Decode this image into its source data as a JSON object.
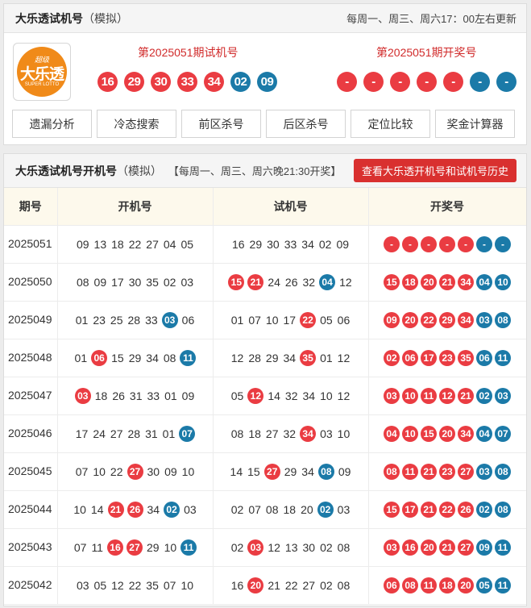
{
  "top": {
    "title": "大乐透试机号",
    "mode": "（模拟）",
    "schedule": "每周一、周三、周六17：00左右更新",
    "logo": {
      "top": "超级",
      "main": "大乐透",
      "sub": "SUPER LOTTO"
    },
    "trial_label": "第2025051期试机号",
    "trial_numbers": {
      "front": [
        "16",
        "29",
        "30",
        "33",
        "34"
      ],
      "back": [
        "02",
        "09"
      ]
    },
    "draw_label": "第2025051期开奖号",
    "draw_numbers": {
      "front": [
        "-",
        "-",
        "-",
        "-",
        "-"
      ],
      "back": [
        "-",
        "-"
      ]
    },
    "tools": [
      "遗漏分析",
      "冷态搜索",
      "前区杀号",
      "后区杀号",
      "定位比较",
      "奖金计算器"
    ]
  },
  "history": {
    "title": "大乐透试机号开机号",
    "mode": "（模拟）",
    "note": "【每周一、周三、周六晚21:30开奖】",
    "button": "查看大乐透开机号和试机号历史",
    "columns": [
      "期号",
      "开机号",
      "试机号",
      "开奖号"
    ],
    "rows": [
      {
        "issue": "2025051",
        "open": [
          [
            "09",
            "n"
          ],
          [
            "13",
            "n"
          ],
          [
            "18",
            "n"
          ],
          [
            "22",
            "n"
          ],
          [
            "27",
            "n"
          ],
          [
            "04",
            "n"
          ],
          [
            "05",
            "n"
          ]
        ],
        "trial": [
          [
            "16",
            "n"
          ],
          [
            "29",
            "n"
          ],
          [
            "30",
            "n"
          ],
          [
            "33",
            "n"
          ],
          [
            "34",
            "n"
          ],
          [
            "02",
            "n"
          ],
          [
            "09",
            "n"
          ]
        ],
        "draw": [
          [
            "-",
            "r"
          ],
          [
            "-",
            "r"
          ],
          [
            "-",
            "r"
          ],
          [
            "-",
            "r"
          ],
          [
            "-",
            "r"
          ],
          [
            "-",
            "b"
          ],
          [
            "-",
            "b"
          ]
        ]
      },
      {
        "issue": "2025050",
        "open": [
          [
            "08",
            "n"
          ],
          [
            "09",
            "n"
          ],
          [
            "17",
            "n"
          ],
          [
            "30",
            "n"
          ],
          [
            "35",
            "n"
          ],
          [
            "02",
            "n"
          ],
          [
            "03",
            "n"
          ]
        ],
        "trial": [
          [
            "15",
            "r"
          ],
          [
            "21",
            "r"
          ],
          [
            "24",
            "n"
          ],
          [
            "26",
            "n"
          ],
          [
            "32",
            "n"
          ],
          [
            "04",
            "b"
          ],
          [
            "12",
            "n"
          ]
        ],
        "draw": [
          [
            "15",
            "r"
          ],
          [
            "18",
            "r"
          ],
          [
            "20",
            "r"
          ],
          [
            "21",
            "r"
          ],
          [
            "34",
            "r"
          ],
          [
            "04",
            "b"
          ],
          [
            "10",
            "b"
          ]
        ]
      },
      {
        "issue": "2025049",
        "open": [
          [
            "01",
            "n"
          ],
          [
            "23",
            "n"
          ],
          [
            "25",
            "n"
          ],
          [
            "28",
            "n"
          ],
          [
            "33",
            "n"
          ],
          [
            "03",
            "b"
          ],
          [
            "06",
            "n"
          ]
        ],
        "trial": [
          [
            "01",
            "n"
          ],
          [
            "07",
            "n"
          ],
          [
            "10",
            "n"
          ],
          [
            "17",
            "n"
          ],
          [
            "22",
            "r"
          ],
          [
            "05",
            "n"
          ],
          [
            "06",
            "n"
          ]
        ],
        "draw": [
          [
            "09",
            "r"
          ],
          [
            "20",
            "r"
          ],
          [
            "22",
            "r"
          ],
          [
            "29",
            "r"
          ],
          [
            "34",
            "r"
          ],
          [
            "03",
            "b"
          ],
          [
            "08",
            "b"
          ]
        ]
      },
      {
        "issue": "2025048",
        "open": [
          [
            "01",
            "n"
          ],
          [
            "06",
            "r"
          ],
          [
            "15",
            "n"
          ],
          [
            "29",
            "n"
          ],
          [
            "34",
            "n"
          ],
          [
            "08",
            "n"
          ],
          [
            "11",
            "b"
          ]
        ],
        "trial": [
          [
            "12",
            "n"
          ],
          [
            "28",
            "n"
          ],
          [
            "29",
            "n"
          ],
          [
            "34",
            "n"
          ],
          [
            "35",
            "r"
          ],
          [
            "01",
            "n"
          ],
          [
            "12",
            "n"
          ]
        ],
        "draw": [
          [
            "02",
            "r"
          ],
          [
            "06",
            "r"
          ],
          [
            "17",
            "r"
          ],
          [
            "23",
            "r"
          ],
          [
            "35",
            "r"
          ],
          [
            "06",
            "b"
          ],
          [
            "11",
            "b"
          ]
        ]
      },
      {
        "issue": "2025047",
        "open": [
          [
            "03",
            "r"
          ],
          [
            "18",
            "n"
          ],
          [
            "26",
            "n"
          ],
          [
            "31",
            "n"
          ],
          [
            "33",
            "n"
          ],
          [
            "01",
            "n"
          ],
          [
            "09",
            "n"
          ]
        ],
        "trial": [
          [
            "05",
            "n"
          ],
          [
            "12",
            "r"
          ],
          [
            "14",
            "n"
          ],
          [
            "32",
            "n"
          ],
          [
            "34",
            "n"
          ],
          [
            "10",
            "n"
          ],
          [
            "12",
            "n"
          ]
        ],
        "draw": [
          [
            "03",
            "r"
          ],
          [
            "10",
            "r"
          ],
          [
            "11",
            "r"
          ],
          [
            "12",
            "r"
          ],
          [
            "21",
            "r"
          ],
          [
            "02",
            "b"
          ],
          [
            "03",
            "b"
          ]
        ]
      },
      {
        "issue": "2025046",
        "open": [
          [
            "17",
            "n"
          ],
          [
            "24",
            "n"
          ],
          [
            "27",
            "n"
          ],
          [
            "28",
            "n"
          ],
          [
            "31",
            "n"
          ],
          [
            "01",
            "n"
          ],
          [
            "07",
            "b"
          ]
        ],
        "trial": [
          [
            "08",
            "n"
          ],
          [
            "18",
            "n"
          ],
          [
            "27",
            "n"
          ],
          [
            "32",
            "n"
          ],
          [
            "34",
            "r"
          ],
          [
            "03",
            "n"
          ],
          [
            "10",
            "n"
          ]
        ],
        "draw": [
          [
            "04",
            "r"
          ],
          [
            "10",
            "r"
          ],
          [
            "15",
            "r"
          ],
          [
            "20",
            "r"
          ],
          [
            "34",
            "r"
          ],
          [
            "04",
            "b"
          ],
          [
            "07",
            "b"
          ]
        ]
      },
      {
        "issue": "2025045",
        "open": [
          [
            "07",
            "n"
          ],
          [
            "10",
            "n"
          ],
          [
            "22",
            "n"
          ],
          [
            "27",
            "r"
          ],
          [
            "30",
            "n"
          ],
          [
            "09",
            "n"
          ],
          [
            "10",
            "n"
          ]
        ],
        "trial": [
          [
            "14",
            "n"
          ],
          [
            "15",
            "n"
          ],
          [
            "27",
            "r"
          ],
          [
            "29",
            "n"
          ],
          [
            "34",
            "n"
          ],
          [
            "08",
            "b"
          ],
          [
            "09",
            "n"
          ]
        ],
        "draw": [
          [
            "08",
            "r"
          ],
          [
            "11",
            "r"
          ],
          [
            "21",
            "r"
          ],
          [
            "23",
            "r"
          ],
          [
            "27",
            "r"
          ],
          [
            "03",
            "b"
          ],
          [
            "08",
            "b"
          ]
        ]
      },
      {
        "issue": "2025044",
        "open": [
          [
            "10",
            "n"
          ],
          [
            "14",
            "n"
          ],
          [
            "21",
            "r"
          ],
          [
            "26",
            "r"
          ],
          [
            "34",
            "n"
          ],
          [
            "02",
            "b"
          ],
          [
            "03",
            "n"
          ]
        ],
        "trial": [
          [
            "02",
            "n"
          ],
          [
            "07",
            "n"
          ],
          [
            "08",
            "n"
          ],
          [
            "18",
            "n"
          ],
          [
            "20",
            "n"
          ],
          [
            "02",
            "b"
          ],
          [
            "03",
            "n"
          ]
        ],
        "draw": [
          [
            "15",
            "r"
          ],
          [
            "17",
            "r"
          ],
          [
            "21",
            "r"
          ],
          [
            "22",
            "r"
          ],
          [
            "26",
            "r"
          ],
          [
            "02",
            "b"
          ],
          [
            "08",
            "b"
          ]
        ]
      },
      {
        "issue": "2025043",
        "open": [
          [
            "07",
            "n"
          ],
          [
            "11",
            "n"
          ],
          [
            "16",
            "r"
          ],
          [
            "27",
            "r"
          ],
          [
            "29",
            "n"
          ],
          [
            "10",
            "n"
          ],
          [
            "11",
            "b"
          ]
        ],
        "trial": [
          [
            "02",
            "n"
          ],
          [
            "03",
            "r"
          ],
          [
            "12",
            "n"
          ],
          [
            "13",
            "n"
          ],
          [
            "30",
            "n"
          ],
          [
            "02",
            "n"
          ],
          [
            "08",
            "n"
          ]
        ],
        "draw": [
          [
            "03",
            "r"
          ],
          [
            "16",
            "r"
          ],
          [
            "20",
            "r"
          ],
          [
            "21",
            "r"
          ],
          [
            "27",
            "r"
          ],
          [
            "09",
            "b"
          ],
          [
            "11",
            "b"
          ]
        ]
      },
      {
        "issue": "2025042",
        "open": [
          [
            "03",
            "n"
          ],
          [
            "05",
            "n"
          ],
          [
            "12",
            "n"
          ],
          [
            "22",
            "n"
          ],
          [
            "35",
            "n"
          ],
          [
            "07",
            "n"
          ],
          [
            "10",
            "n"
          ]
        ],
        "trial": [
          [
            "16",
            "n"
          ],
          [
            "20",
            "r"
          ],
          [
            "21",
            "n"
          ],
          [
            "22",
            "n"
          ],
          [
            "27",
            "n"
          ],
          [
            "02",
            "n"
          ],
          [
            "08",
            "n"
          ]
        ],
        "draw": [
          [
            "06",
            "r"
          ],
          [
            "08",
            "r"
          ],
          [
            "11",
            "r"
          ],
          [
            "18",
            "r"
          ],
          [
            "20",
            "r"
          ],
          [
            "05",
            "b"
          ],
          [
            "11",
            "b"
          ]
        ]
      }
    ]
  }
}
